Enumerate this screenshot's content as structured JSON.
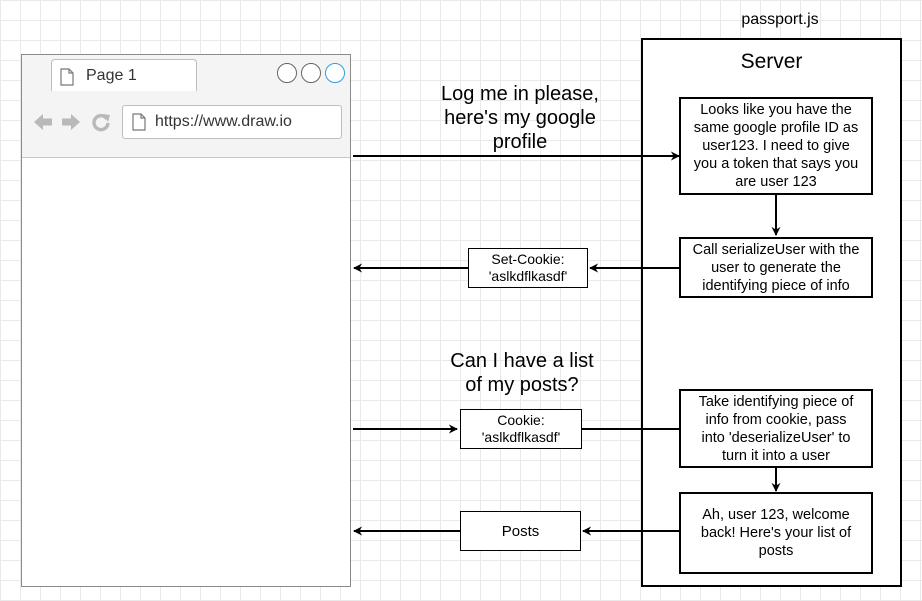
{
  "browser": {
    "tab_label": "Page 1",
    "url": "https://www.draw.io",
    "icons": [
      "document-icon",
      "back-arrow-icon",
      "forward-arrow-icon",
      "refresh-icon"
    ]
  },
  "server": {
    "caption": "passport.js",
    "title": "Server",
    "step1": "Looks like you have the\nsame google profile ID as\nuser123.  I need to give\nyou a token that says you\nare user 123",
    "step2": "Call serializeUser with the\nuser to generate the\nidentifying piece of info",
    "step3": "Take identifying piece of\ninfo from cookie, pass\ninto 'deserializeUser' to\nturn it into a user",
    "step4": "Ah, user 123, welcome\nback!  Here's your list of\nposts"
  },
  "messages": {
    "login_request": "Log me in please,\nhere's my google\nprofile",
    "set_cookie": "Set-Cookie:\n'aslkdflkasdf'",
    "posts_request": "Can I have a list\nof my posts?",
    "cookie": "Cookie:\n'aslkdflkasdf'",
    "posts_response": "Posts"
  },
  "colors": {
    "window_button_accent": "#2d9ee0",
    "stroke": "#000000"
  }
}
